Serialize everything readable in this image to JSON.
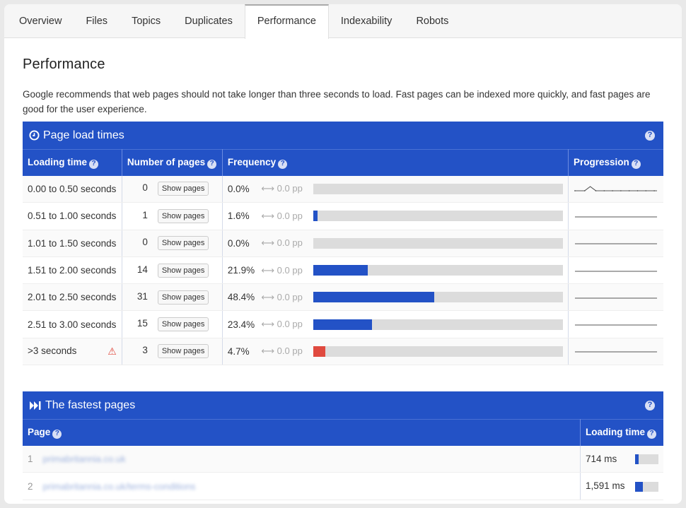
{
  "tabs": [
    "Overview",
    "Files",
    "Topics",
    "Duplicates",
    "Performance",
    "Indexability",
    "Robots"
  ],
  "active_tab": "Performance",
  "page_title": "Performance",
  "intro": "Google recommends that web pages should not take longer than three seconds to load. Fast pages can be indexed more quickly, and fast pages are good for the user experience.",
  "load_panel": {
    "title": "Page load times",
    "icon": "clock-icon",
    "columns": [
      "Loading time",
      "Number of pages",
      "Frequency",
      "Progression"
    ],
    "show_label": "Show pages",
    "rows": [
      {
        "range": "0.00 to 0.50 seconds",
        "count": "0",
        "freq": "0.0%",
        "change": "0.0 pp",
        "pct": 0.0,
        "warn": false
      },
      {
        "range": "0.51 to 1.00 seconds",
        "count": "1",
        "freq": "1.6%",
        "change": "0.0 pp",
        "pct": 1.6,
        "warn": false
      },
      {
        "range": "1.01 to 1.50 seconds",
        "count": "0",
        "freq": "0.0%",
        "change": "0.0 pp",
        "pct": 0.0,
        "warn": false
      },
      {
        "range": "1.51 to 2.00 seconds",
        "count": "14",
        "freq": "21.9%",
        "change": "0.0 pp",
        "pct": 21.9,
        "warn": false
      },
      {
        "range": "2.01 to 2.50 seconds",
        "count": "31",
        "freq": "48.4%",
        "change": "0.0 pp",
        "pct": 48.4,
        "warn": false
      },
      {
        "range": "2.51 to 3.00 seconds",
        "count": "15",
        "freq": "23.4%",
        "change": "0.0 pp",
        "pct": 23.4,
        "warn": false
      },
      {
        "range": ">3 seconds",
        "count": "3",
        "freq": "4.7%",
        "change": "0.0 pp",
        "pct": 4.7,
        "warn": true
      }
    ]
  },
  "fast_panel": {
    "title": "The fastest pages",
    "icon": "fast-forward-icon",
    "columns": [
      "Page",
      "Loading time"
    ],
    "rows": [
      {
        "rank": "1",
        "page": "primabritannia.co.uk",
        "time": "714 ms",
        "pct": 15
      },
      {
        "rank": "2",
        "page": "primabritannia.co.uk/terms-conditions",
        "time": "1,591 ms",
        "pct": 33
      }
    ]
  },
  "colors": {
    "accent": "#2352c6",
    "warning": "#e04a3f",
    "bar_bg": "#dcdcdc"
  }
}
